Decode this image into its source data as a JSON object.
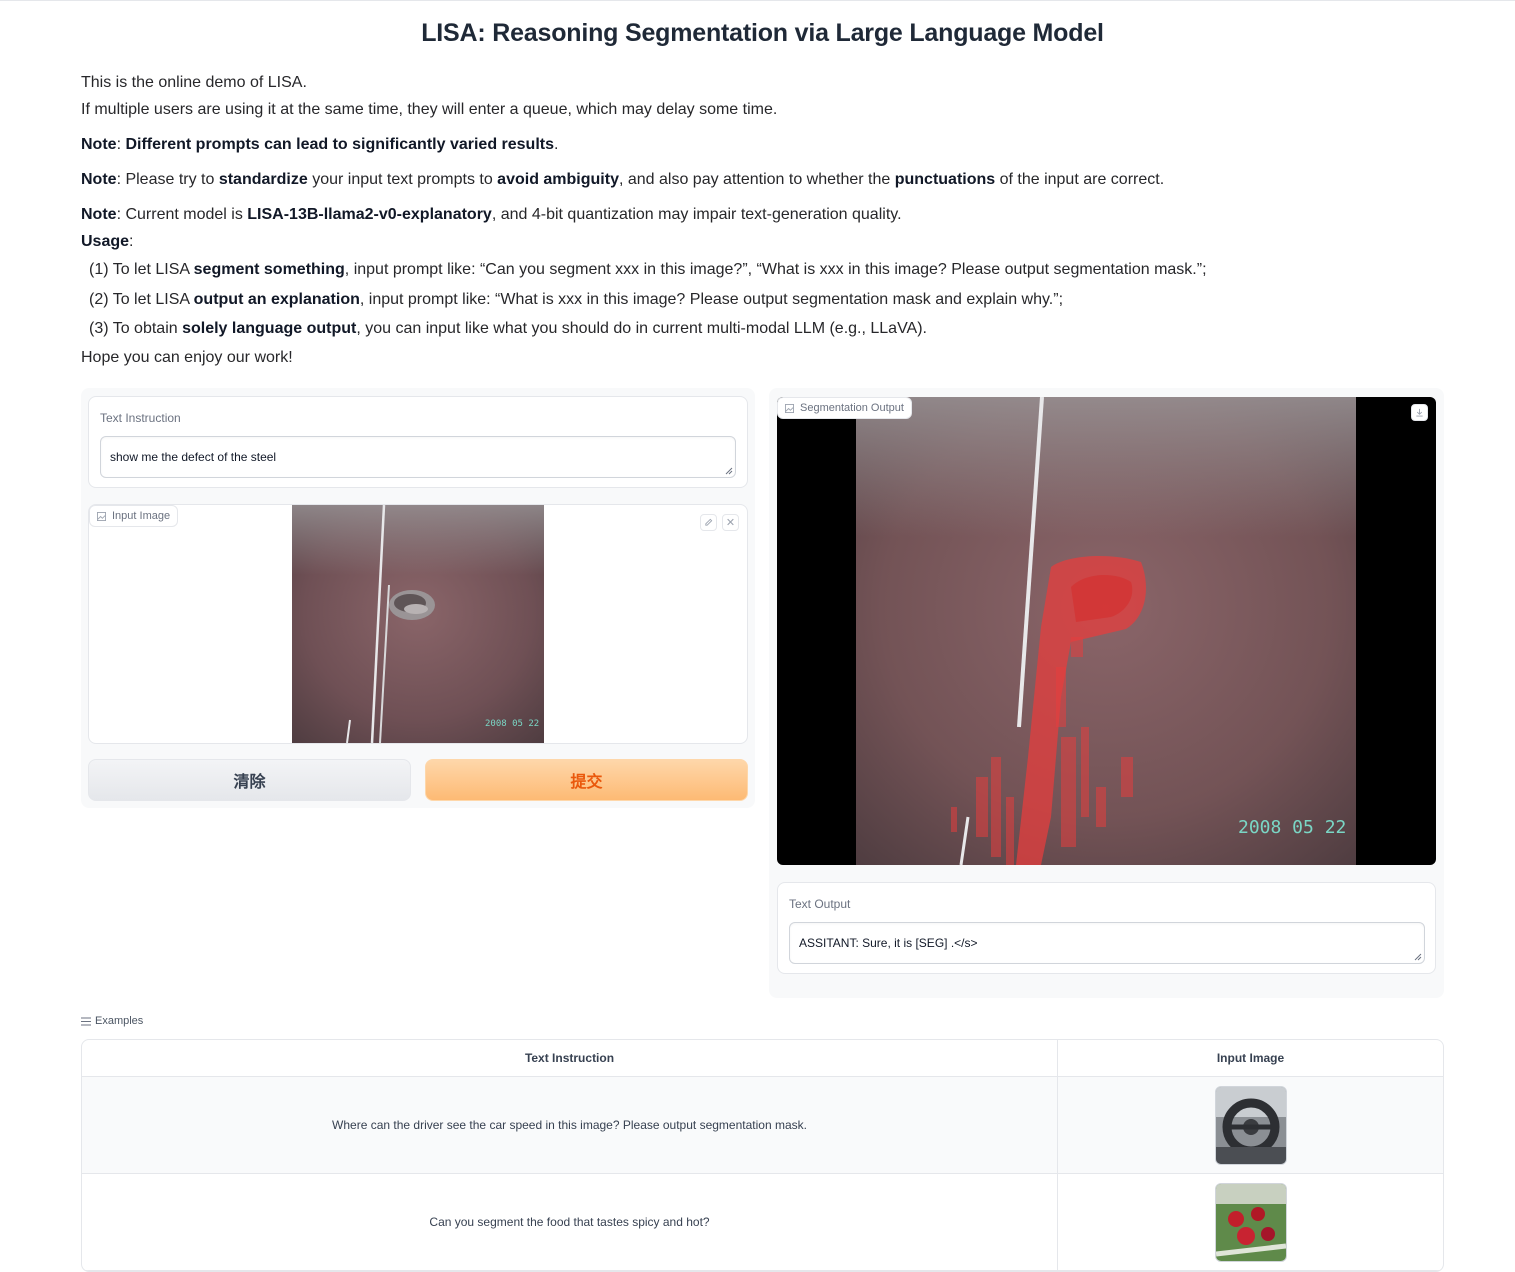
{
  "header": {
    "title": "LISA: Reasoning Segmentation via Large Language Model"
  },
  "description": {
    "line1": "This is the online demo of LISA.",
    "line2": "If multiple users are using it at the same time, they will enter a queue, which may delay some time.",
    "note1_label": "Note",
    "note1_text": "Different prompts can lead to significantly varied results",
    "note2_label": "Note",
    "note2_a": ": Please try to ",
    "note2_b": "standardize",
    "note2_c": " your input text prompts to ",
    "note2_d": "avoid ambiguity",
    "note2_e": ", and also pay attention to whether the ",
    "note2_f": "punctuations",
    "note2_g": " of the input are correct.",
    "note3_label": "Note",
    "note3_a": ": Current model is ",
    "note3_b": "LISA-13B-llama2-v0-explanatory",
    "note3_c": ", and 4-bit quantization may impair text-generation quality.",
    "usage_label": "Usage",
    "u1_a": "(1) To let LISA ",
    "u1_b": "segment something",
    "u1_c": ", input prompt like: “Can you segment xxx in this image?”, “What is xxx in this image? Please output segmentation mask.”;",
    "u2_a": "(2) To let LISA ",
    "u2_b": "output an explanation",
    "u2_c": ", input prompt like: “What is xxx in this image? Please output segmentation mask and explain why.”;",
    "u3_a": "(3) To obtain ",
    "u3_b": "solely language output",
    "u3_c": ", you can input like what you should do in current multi-modal LLM (e.g., LLaVA).",
    "outro": "Hope you can enjoy our work!"
  },
  "input": {
    "text_label": "Text Instruction",
    "text_value": "show me the defect of the steel",
    "image_label": "Input Image",
    "image_date": "2008 05 22"
  },
  "buttons": {
    "clear": "清除",
    "submit": "提交"
  },
  "output": {
    "seg_label": "Segmentation Output",
    "image_date": "2008 05 22",
    "text_label": "Text Output",
    "text_value": "ASSITANT: Sure, it is [SEG] .</s>"
  },
  "examples": {
    "label": "Examples",
    "headers": [
      "Text Instruction",
      "Input Image"
    ],
    "rows": [
      {
        "text": "Where can the driver see the car speed in this image? Please output segmentation mask."
      },
      {
        "text": "Can you segment the food that tastes spicy and hot?"
      }
    ]
  },
  "colors": {
    "accent": "#ea580c",
    "mask": "#e53e3e",
    "steel": "#7a5a5e"
  }
}
